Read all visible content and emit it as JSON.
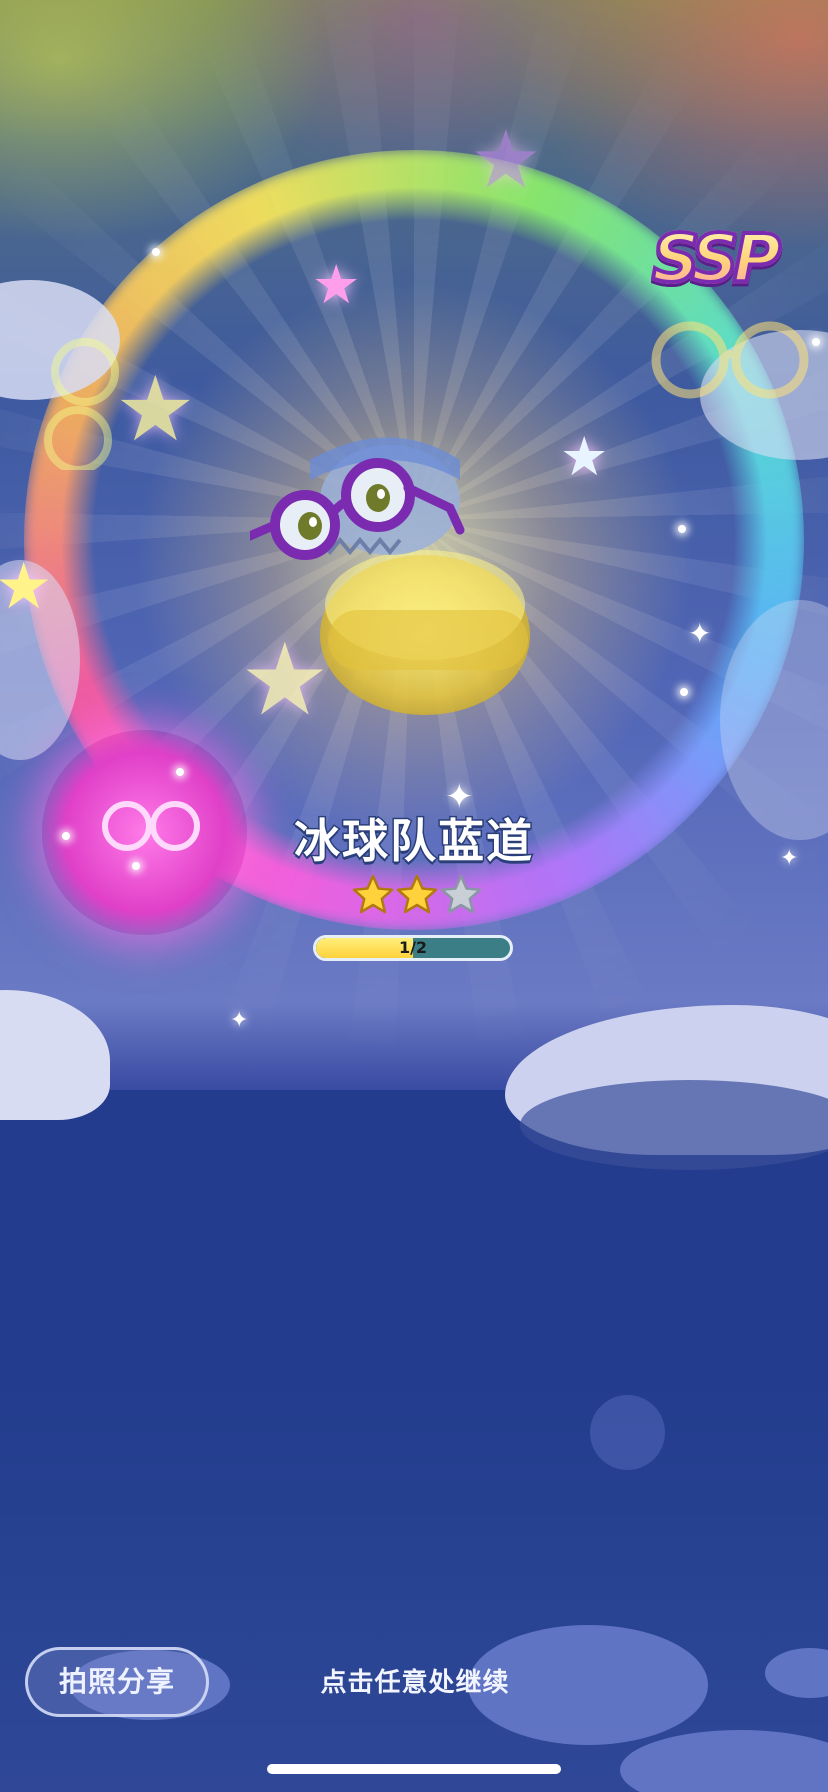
{
  "item": {
    "name": "冰球队蓝道",
    "rarity_badge": "SSP",
    "rating": {
      "filled": 2,
      "total": 3
    },
    "progress": {
      "current": 1,
      "total": 2,
      "label": "1/2",
      "fraction": 0.5
    }
  },
  "actions": {
    "share_label": "拍照分享",
    "continue_hint": "点击任意处继续"
  },
  "icons": {
    "ssp": "ssp-badge",
    "glasses": "glasses-icon",
    "star_filled": "star-filled-icon",
    "star_empty": "star-empty-icon"
  },
  "colors": {
    "star_filled": "#ffd23c",
    "star_empty": "#c9cfd6",
    "progress_fill": "#ffd23c",
    "progress_track": "#3c7e86",
    "glasses_frame": "#7a2bb0"
  }
}
